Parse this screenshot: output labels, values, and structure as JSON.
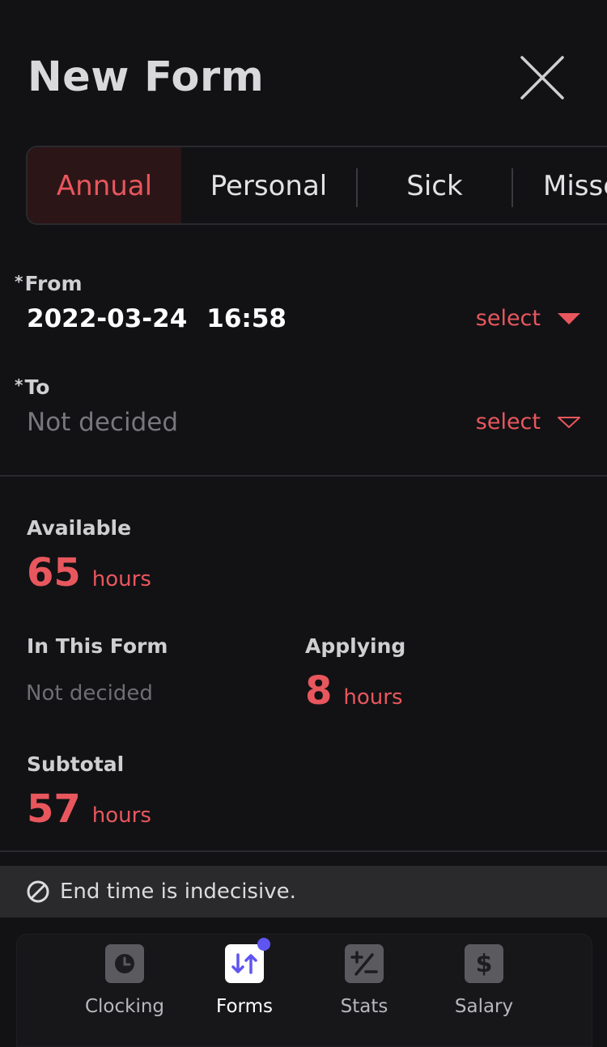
{
  "header": {
    "title": "New Form"
  },
  "tabs": [
    {
      "label": "Annual",
      "active": true
    },
    {
      "label": "Personal",
      "active": false
    },
    {
      "label": "Sick",
      "active": false
    },
    {
      "label": "Missed",
      "active": false
    }
  ],
  "from": {
    "required_mark": "*",
    "label": "From",
    "date": "2022-03-24",
    "time": "16:58",
    "select_label": "select"
  },
  "to": {
    "required_mark": "*",
    "label": "To",
    "value": "Not decided",
    "select_label": "select"
  },
  "available": {
    "label": "Available",
    "value": "65",
    "unit": "hours"
  },
  "in_this_form": {
    "label": "In This Form",
    "value": "Not decided"
  },
  "applying": {
    "label": "Applying",
    "value": "8",
    "unit": "hours"
  },
  "subtotal": {
    "label": "Subtotal",
    "value": "57",
    "unit": "hours"
  },
  "toast": {
    "text": "End time is indecisive."
  },
  "nav": {
    "items": [
      {
        "label": "Clocking",
        "icon": "clock-icon"
      },
      {
        "label": "Forms",
        "icon": "swap-arrows-icon"
      },
      {
        "label": "Stats",
        "icon": "plus-minus-icon"
      },
      {
        "label": "Salary",
        "icon": "dollar-icon"
      }
    ]
  },
  "colors": {
    "accent": "#e8575d",
    "background": "#121215",
    "badge": "#5e55f0"
  }
}
